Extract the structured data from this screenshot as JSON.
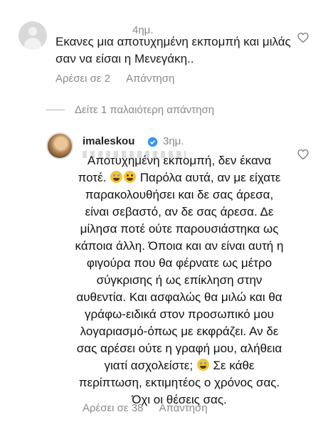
{
  "comment1": {
    "time": "4ημ.",
    "text": "Εκανες μια αποτυχημένη εκπομπή και μιλάς σαν να είσαι η Μενεγάκη..",
    "likes_label": "Αρέσει σε 2",
    "reply_label": "Απάντηση"
  },
  "earlier_replies": {
    "label": "Δείτε 1 παλαιότερη απάντηση"
  },
  "reply": {
    "username": "imaleskou",
    "time": "3ημ.",
    "text_parts": {
      "p1": "Αποτυχημένη εκπομπή, δεν έκανα ποτέ. ",
      "p2": " Παρόλα αυτά, αν με είχατε παρακολουθήσει και δε σας άρεσα, είναι σεβαστό, αν δε σας άρεσα. Δε μίλησα ποτέ ούτε παρουσιάστηκα ως κάποια άλλη.  Όποια και αν είναι αυτή η φιγούρα που θα φέρνατε ως μέτρο σύγκρισης ή ως επίκληση στην αυθεντία. Και ασφαλώς θα μιλώ και θα γράφω-ειδικά στον προσωπικό μου λογαριασμό-όπως με εκφράζει. Αν δε σας αρέσει ούτε η γραφή μου, αλήθεια γιατί ασχολείστε; ",
      "p3": " Σε κάθε περίπτωση, εκτιμητέος ο χρόνος σας. Όχι οι θέσεις σας."
    },
    "likes_label": "Αρέσει σε 38",
    "reply_label": "Απάντηση"
  },
  "icons": {
    "heart": "heart-outline-icon",
    "verified": "verified-badge-icon",
    "emoji_laugh": "face-with-tears-of-joy-icon",
    "emoji_wink": "winking-face-icon"
  },
  "colors": {
    "secondary_text": "#8a8a8a",
    "verified_blue": "#3897f0"
  }
}
